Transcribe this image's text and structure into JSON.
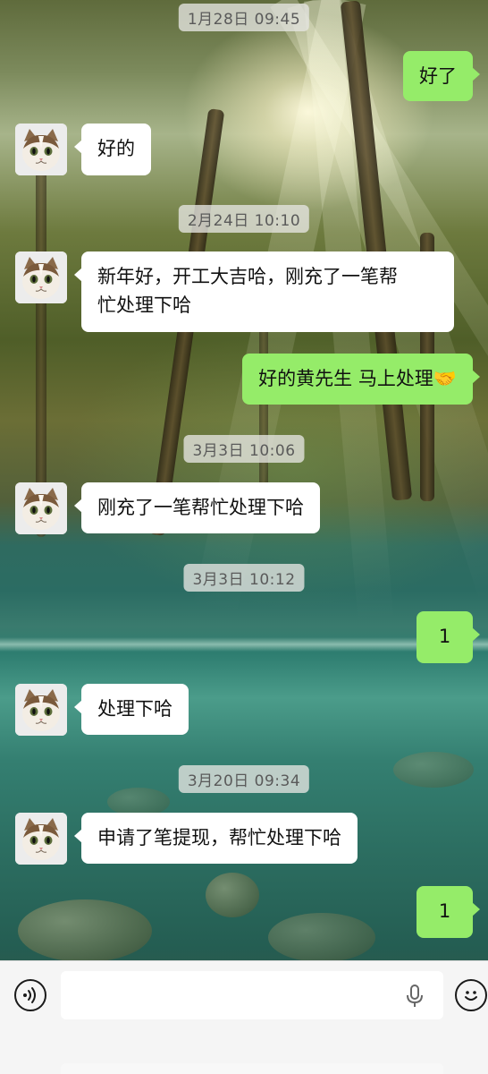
{
  "timestamps": {
    "t1": "1月28日 09:45",
    "t2": "2月24日 10:10",
    "t3": "3月3日 10:06",
    "t4": "3月3日 10:12",
    "t5": "3月20日 09:34"
  },
  "messages": {
    "m1": {
      "side": "right",
      "text": "好了"
    },
    "m2": {
      "side": "left",
      "text": "好的"
    },
    "m3_line1": {
      "side": "left",
      "text": "新年好，开工大吉哈，刚充了一笔帮"
    },
    "m3_line2": {
      "text": "忙处理下哈"
    },
    "m4": {
      "side": "right",
      "text": "好的黄先生 马上处理🤝"
    },
    "m5": {
      "side": "left",
      "text": "刚充了一笔帮忙处理下哈"
    },
    "m6": {
      "side": "right",
      "text": "1"
    },
    "m7": {
      "side": "left",
      "text": "处理下哈"
    },
    "m8": {
      "side": "left",
      "text": "申请了笔提现，帮忙处理下哈"
    },
    "m9": {
      "side": "right",
      "text": "1"
    }
  },
  "input_bar": {
    "left_icon": "voice-icon",
    "mic_icon": "microphone-icon",
    "right_icon": "emoji-icon",
    "text": ""
  },
  "colors": {
    "bubble_self": "#95ec69",
    "bubble_other": "#ffffff",
    "timestamp_bg": "#e6e6e1"
  }
}
